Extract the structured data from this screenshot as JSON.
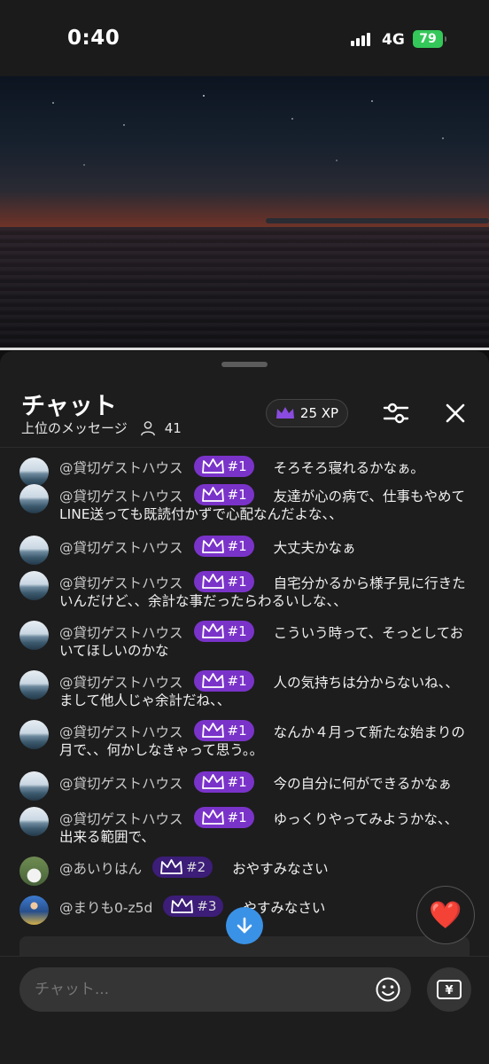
{
  "status_bar": {
    "time": "0:40",
    "network": "4G",
    "battery": "79"
  },
  "chat": {
    "title": "チャット",
    "subtitle": "上位のメッセージ",
    "viewer_count": "41",
    "xp_label": "25 XP",
    "input_placeholder": "チャット...",
    "heart_emoji": "❤️",
    "yen_label": "¥"
  },
  "messages": [
    {
      "user": "@貸切ゲストハウス",
      "rank": "#1",
      "text": "そろそろ寝れるかなぁ。",
      "avatar": "beach"
    },
    {
      "user": "@貸切ゲストハウス",
      "rank": "#1",
      "text": "友達が心の病で、仕事もやめてLINE送っても既読付かずで心配なんだよな、、",
      "avatar": "beach"
    },
    {
      "user": "@貸切ゲストハウス",
      "rank": "#1",
      "text": "大丈夫かなぁ",
      "avatar": "beach"
    },
    {
      "user": "@貸切ゲストハウス",
      "rank": "#1",
      "text": "自宅分かるから様子見に行きたいんだけど、、余計な事だったらわるいしな、、",
      "avatar": "beach"
    },
    {
      "user": "@貸切ゲストハウス",
      "rank": "#1",
      "text": "こういう時って、そっとしておいてほしいのかな",
      "avatar": "beach"
    },
    {
      "user": "@貸切ゲストハウス",
      "rank": "#1",
      "text": "人の気持ちは分からないね、、まして他人じゃ余計だね、、",
      "avatar": "beach"
    },
    {
      "user": "@貸切ゲストハウス",
      "rank": "#1",
      "text": "なんか４月って新たな始まりの月で、、何かしなきゃって思う。。",
      "avatar": "beach"
    },
    {
      "user": "@貸切ゲストハウス",
      "rank": "#1",
      "text": "今の自分に何ができるかなぁ",
      "avatar": "beach"
    },
    {
      "user": "@貸切ゲストハウス",
      "rank": "#1",
      "text": "ゆっくりやってみようかな、、出来る範囲で、",
      "avatar": "beach"
    },
    {
      "user": "@あいりはん",
      "rank": "#2",
      "text": "おやすみなさい",
      "avatar": "bunny"
    },
    {
      "user": "@まりも0-z5d",
      "rank": "#3",
      "text": "やすみなさい",
      "avatar": "fig"
    }
  ],
  "colors": {
    "badge_top": "#7a33c9",
    "badge_other": "#3c1d78",
    "accent_blue": "#3a92e6"
  }
}
